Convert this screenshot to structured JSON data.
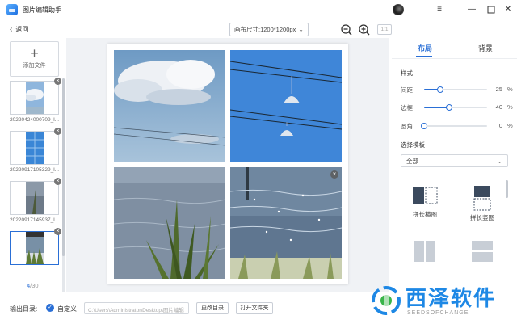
{
  "app": {
    "title": "图片编辑助手"
  },
  "toolbar": {
    "back_label": "返回",
    "canvas_size_label": "画布尺寸:1200*1200px",
    "ratio_label": "1:1"
  },
  "left_panel": {
    "add_file_label": "添加文件",
    "files": [
      {
        "name": "20220424000709_l...",
        "img": "clouds"
      },
      {
        "name": "20220917105329_l...",
        "img": "building"
      },
      {
        "name": "20220917145937_l...",
        "img": "lake"
      },
      {
        "name": "",
        "img": "grass"
      }
    ],
    "page_current": "4",
    "page_total": "/30"
  },
  "right_panel": {
    "tabs": {
      "layout": "布局",
      "background": "背景"
    },
    "style_title": "样式",
    "sliders": [
      {
        "label": "间距",
        "value": "25",
        "unit": "%",
        "fraction": 0.25
      },
      {
        "label": "边框",
        "value": "40",
        "unit": "%",
        "fraction": 0.4
      },
      {
        "label": "圆角",
        "value": "0",
        "unit": "%",
        "fraction": 0.0
      }
    ],
    "template_title": "选择模板",
    "template_select": "全部",
    "templates": [
      {
        "label": "拼长横图"
      },
      {
        "label": "拼长竖图"
      },
      {
        "label": ""
      },
      {
        "label": ""
      }
    ]
  },
  "bottom": {
    "output_label": "输出目录:",
    "custom_label": "自定义",
    "path_value": "C:\\Users\\Administrator\\Desktop\\图片编辑",
    "change_dir_label": "更改目录",
    "open_folder_label": "打开文件夹"
  },
  "watermark": {
    "text": "西泽软件",
    "sub": "SEEDSOFCHANGE"
  },
  "colors": {
    "accent": "#2a6fd6",
    "canvas_bg": "#f0f2f5",
    "watermark": "#1e88e5"
  }
}
